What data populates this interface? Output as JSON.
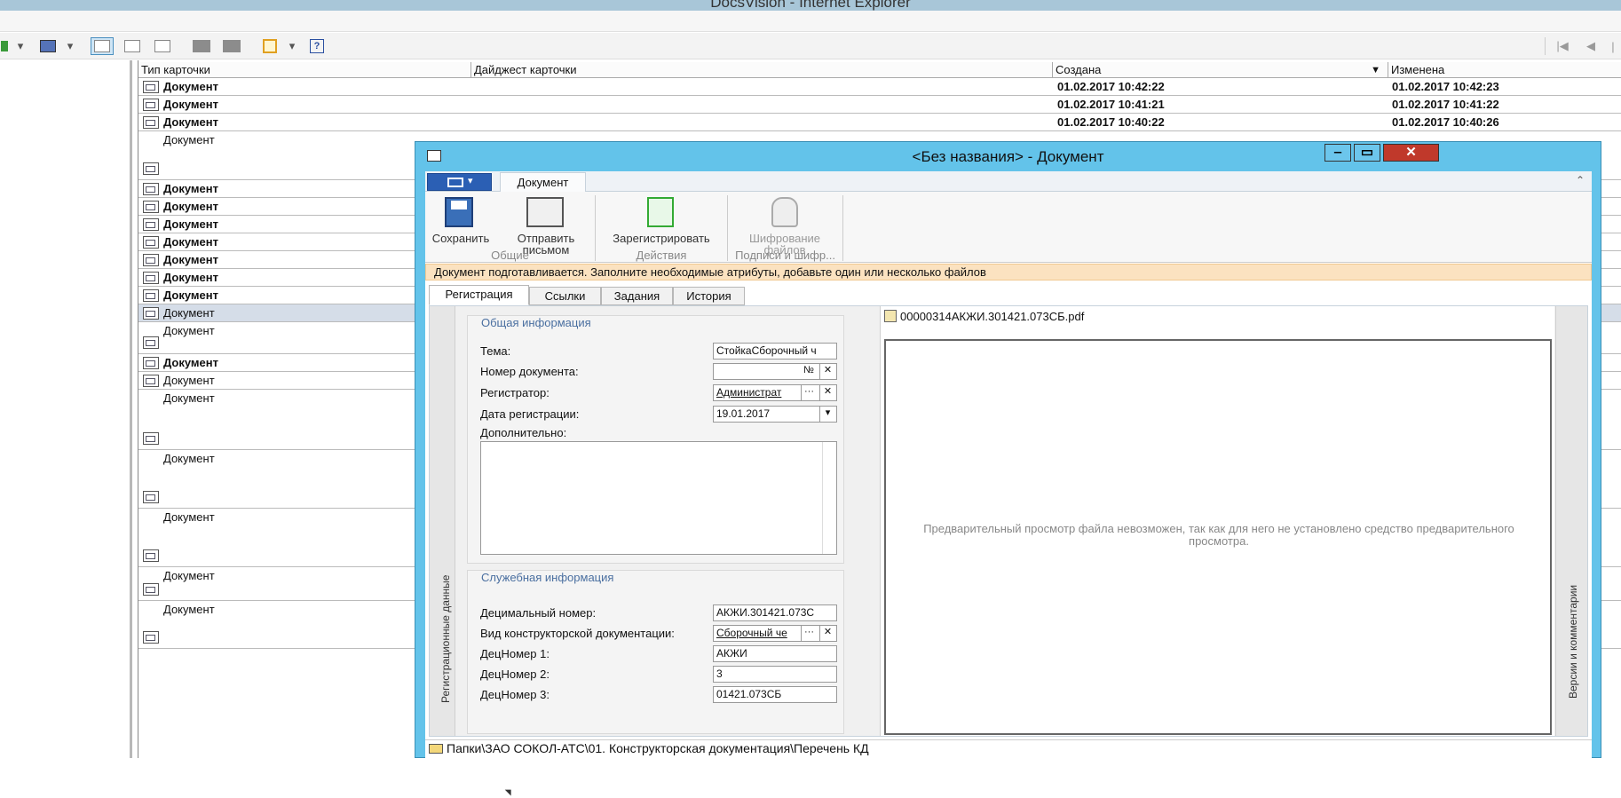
{
  "browser": {
    "title": "DocsVision - Internet Explorer"
  },
  "grid": {
    "columns": [
      "Тип карточки",
      "Дайджест карточки",
      "Создана",
      "Изменена"
    ],
    "rows": [
      {
        "type": "Документ",
        "bold": true,
        "created": "01.02.2017 10:42:22",
        "changed": "01.02.2017 10:42:23"
      },
      {
        "type": "Документ",
        "bold": true,
        "created": "01.02.2017 10:41:21",
        "changed": "01.02.2017 10:41:22"
      },
      {
        "type": "Документ",
        "bold": true,
        "created": "01.02.2017 10:40:22",
        "changed": "01.02.2017 10:40:26"
      },
      {
        "type": "Документ",
        "bold": false,
        "created": "",
        "changed": ""
      },
      {
        "type": "Документ",
        "bold": true,
        "created": "",
        "changed": ""
      },
      {
        "type": "Документ",
        "bold": true,
        "created": "",
        "changed": ""
      },
      {
        "type": "Документ",
        "bold": true,
        "created": "",
        "changed": ""
      },
      {
        "type": "Документ",
        "bold": true,
        "created": "",
        "changed": ""
      },
      {
        "type": "Документ",
        "bold": true,
        "created": "",
        "changed": ""
      },
      {
        "type": "Документ",
        "bold": true,
        "created": "",
        "changed": ""
      },
      {
        "type": "Документ",
        "bold": true,
        "created": "",
        "changed": ""
      },
      {
        "type": "Документ",
        "bold": false,
        "selected": true,
        "created": "",
        "changed": ""
      },
      {
        "type": "Документ",
        "bold": false,
        "created": "",
        "changed": ""
      },
      {
        "type": "Документ",
        "bold": true,
        "created": "",
        "changed": ""
      },
      {
        "type": "Документ",
        "bold": false,
        "created": "",
        "changed": ""
      },
      {
        "type": "Документ",
        "bold": false,
        "created": "",
        "changed": ""
      },
      {
        "type": "Документ",
        "bold": false,
        "created": "",
        "changed": ""
      },
      {
        "type": "Документ",
        "bold": false,
        "created": "",
        "changed": ""
      },
      {
        "type": "Документ",
        "bold": false,
        "created": "",
        "changed": ""
      },
      {
        "type": "Документ",
        "bold": false,
        "created": "",
        "changed": ""
      }
    ]
  },
  "dialog": {
    "title": "<Без названия> - Документ",
    "ribbon_tab": "Документ",
    "buttons": {
      "save": "Сохранить",
      "send": "Отправить письмом",
      "register": "Зарегистрировать",
      "encrypt": "Шифрование файлов"
    },
    "groups": {
      "common": "Общие",
      "actions": "Действия",
      "signatures": "Подписи и шифр..."
    },
    "info": "Документ подготавливается. Заполните необходимые атрибуты, добавьте один или несколько файлов",
    "tabs": [
      "Регистрация",
      "Ссылки",
      "Задания",
      "История"
    ],
    "vtab_left": "Регистрационные данные",
    "vtab_right": "Версии и комментарии",
    "general": {
      "header": "Общая информация",
      "topic_label": "Тема:",
      "topic_value": "СтойкаСборочный ч",
      "number_label": "Номер документа:",
      "number_sign": "№",
      "registrar_label": "Регистратор:",
      "registrar_value": "Администрат",
      "date_label": "Дата регистрации:",
      "date_value": "19.01.2017",
      "extra_label": "Дополнительно:"
    },
    "service": {
      "header": "Служебная информация",
      "decimal_label": "Децимальный номер:",
      "decimal_value": "АКЖИ.301421.073С",
      "kind_label": "Вид конструкторской документации:",
      "kind_value": "Сборочный че",
      "dec1_label": "ДецНомер 1:",
      "dec1_value": "АКЖИ",
      "dec2_label": "ДецНомер 2:",
      "dec2_value": "3",
      "dec3_label": "ДецНомер 3:",
      "dec3_value": "01421.073СБ"
    },
    "preview": {
      "file": "00000314АКЖИ.301421.073СБ.pdf",
      "message": "Предварительный просмотр файла невозможен, так как для него не установлено средство предварительного просмотра."
    },
    "status_path": "Папки\\ЗАО СОКОЛ-АТС\\01. Конструкторская документация\\Перечень КД"
  }
}
